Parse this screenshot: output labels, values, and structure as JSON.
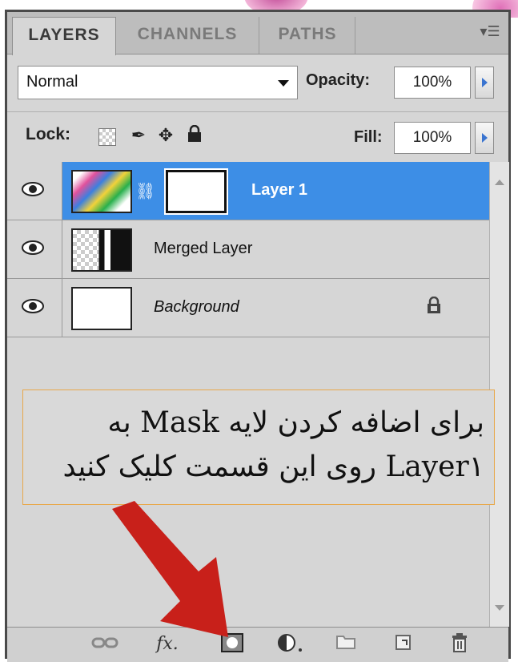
{
  "tabs": [
    {
      "label": "LAYERS",
      "active": true
    },
    {
      "label": "CHANNELS",
      "active": false
    },
    {
      "label": "PATHS",
      "active": false
    }
  ],
  "blend": {
    "mode": "Normal",
    "opacity_label": "Opacity:",
    "opacity_value": "100%"
  },
  "lock": {
    "label": "Lock:",
    "fill_label": "Fill:",
    "fill_value": "100%"
  },
  "layers": [
    {
      "name": "Layer 1",
      "selected": true,
      "has_mask": true
    },
    {
      "name": "Merged Layer",
      "selected": false
    },
    {
      "name": "Background",
      "selected": false,
      "locked": true
    }
  ],
  "callout": {
    "line1": "برای اضافه کردن لایه Mask به",
    "line2": "Layer۱ روی این قسمت کلیک کنید"
  },
  "colors": {
    "selection": "#3d8ee6",
    "arrow": "#c8201a",
    "callout_border": "#e8a84a"
  },
  "toolbar_icons": [
    "link-icon",
    "fx-icon",
    "add-mask-icon",
    "adjustment-icon",
    "folder-icon",
    "new-layer-icon",
    "trash-icon"
  ]
}
